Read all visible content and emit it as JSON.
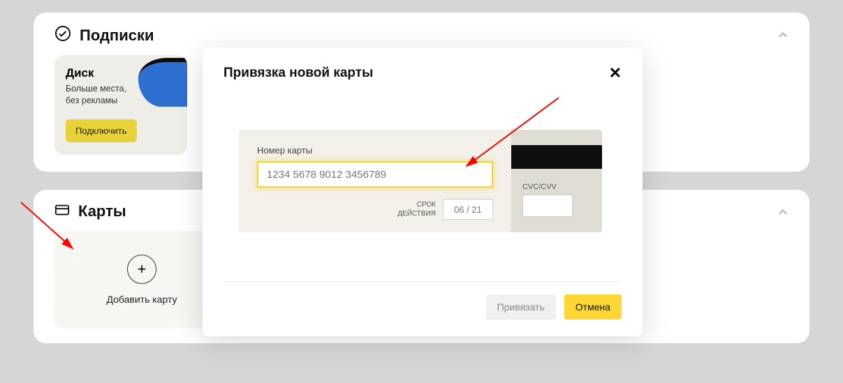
{
  "sections": {
    "subscriptions": {
      "title": "Подписки",
      "card": {
        "title": "Диск",
        "desc": "Больше места,\nбез рекламы",
        "connect_label": "Подключить"
      }
    },
    "cards": {
      "title": "Карты",
      "add_label": "Добавить карту"
    }
  },
  "modal": {
    "title": "Привязка новой карты",
    "card_number_label": "Номер карты",
    "card_number_placeholder": "1234 5678 9012 3456789",
    "expiry_label": "СРОК\nДЕЙСТВИЯ",
    "expiry_placeholder": "06 / 21",
    "cvc_label": "CVC/CVV",
    "link_btn": "Привязать",
    "cancel_btn": "Отмена"
  }
}
